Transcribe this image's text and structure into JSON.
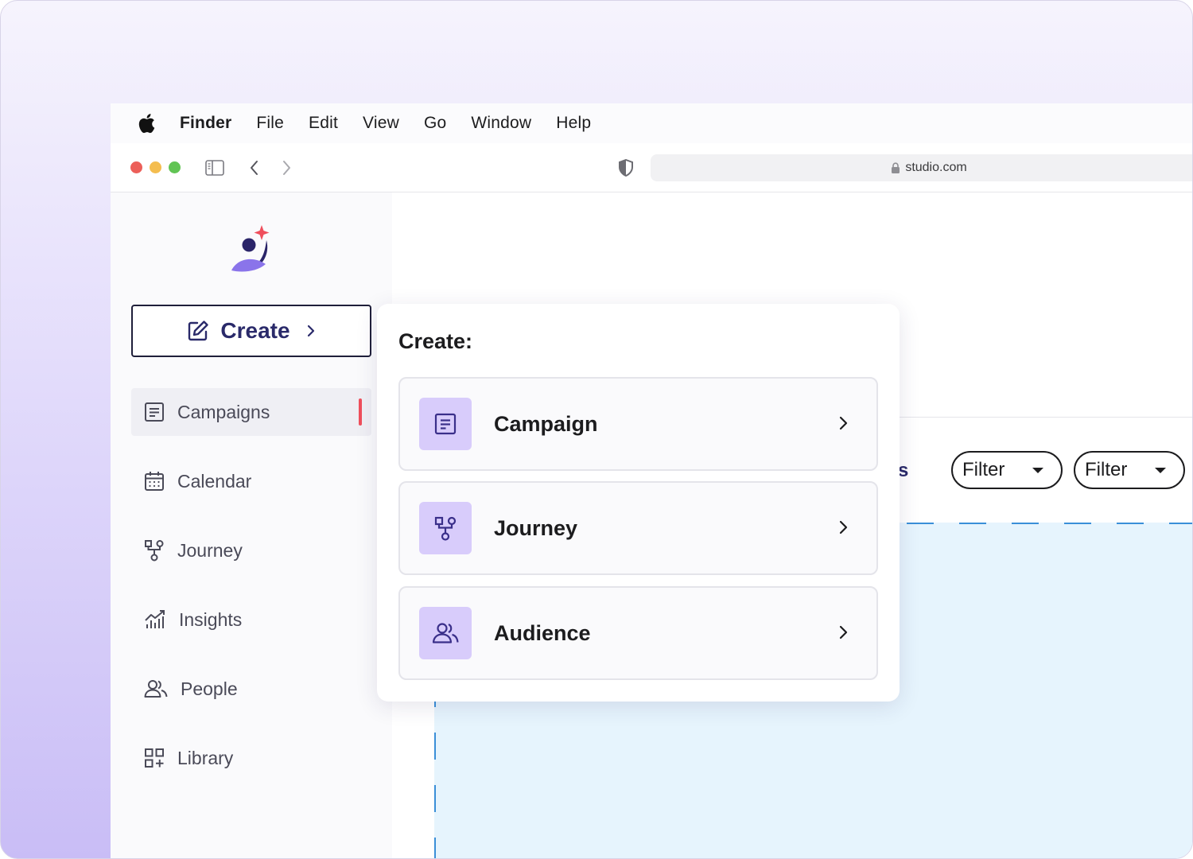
{
  "menubar": {
    "apple_icon": "apple-icon",
    "items": [
      {
        "label": "Finder",
        "bold": true
      },
      {
        "label": "File"
      },
      {
        "label": "Edit"
      },
      {
        "label": "View"
      },
      {
        "label": "Go"
      },
      {
        "label": "Window"
      },
      {
        "label": "Help"
      }
    ]
  },
  "browser": {
    "url": "studio.com",
    "traffic_lights": [
      "#ec5f59",
      "#f4bd4f",
      "#61c454"
    ]
  },
  "sidebar": {
    "create_label": "Create",
    "items": [
      {
        "label": "Campaigns",
        "icon": "list-icon",
        "active": true
      },
      {
        "label": "Calendar",
        "icon": "calendar-icon"
      },
      {
        "label": "Journey",
        "icon": "flow-icon"
      },
      {
        "label": "Insights",
        "icon": "chart-icon"
      },
      {
        "label": "People",
        "icon": "people-icon"
      },
      {
        "label": "Library",
        "icon": "grid-plus-icon"
      }
    ]
  },
  "main": {
    "partial_text": "s",
    "filters": [
      "Filter",
      "Filter"
    ]
  },
  "popover": {
    "title": "Create:",
    "options": [
      {
        "label": "Campaign",
        "icon": "list-icon"
      },
      {
        "label": "Journey",
        "icon": "flow-icon"
      },
      {
        "label": "Audience",
        "icon": "people-icon"
      }
    ]
  },
  "colors": {
    "accent": "#2a2a6a",
    "active_marker": "#ef4f5c",
    "option_icon_bg": "#d8ccfb",
    "dropzone": "#e6f4fd"
  }
}
